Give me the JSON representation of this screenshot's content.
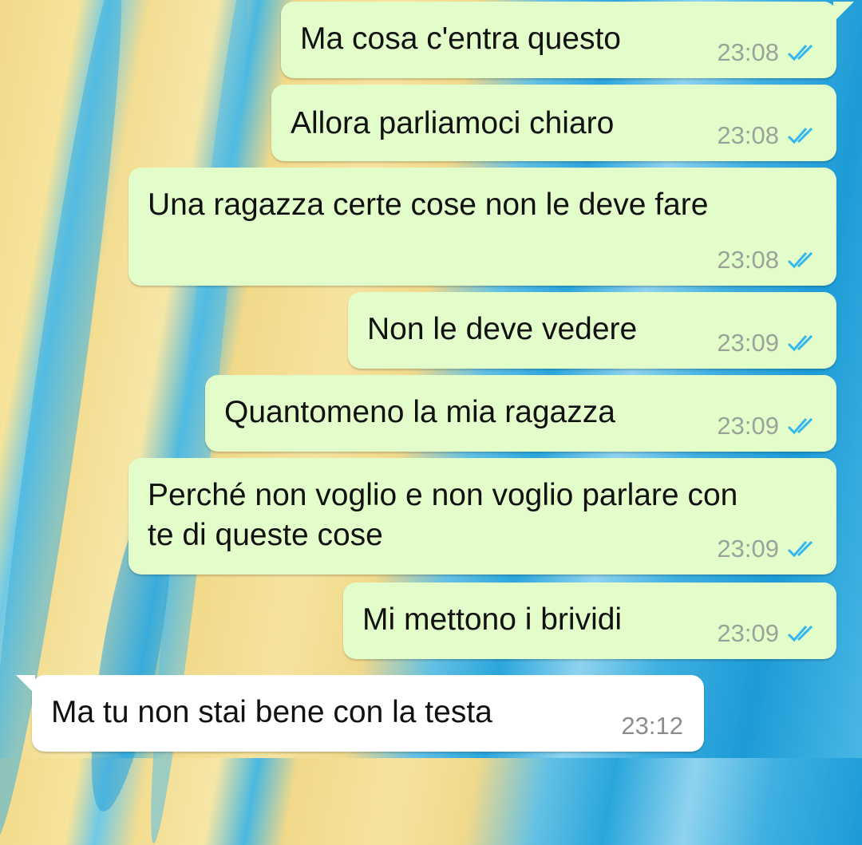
{
  "messages": [
    {
      "text": "Ma cosa c'entra questo",
      "time": "23:08",
      "direction": "outgoing",
      "status": "read"
    },
    {
      "text": "Allora parliamoci chiaro",
      "time": "23:08",
      "direction": "outgoing",
      "status": "read"
    },
    {
      "text": "Una ragazza certe cose non le deve fare",
      "time": "23:08",
      "direction": "outgoing",
      "status": "read"
    },
    {
      "text": "Non le deve vedere",
      "time": "23:09",
      "direction": "outgoing",
      "status": "read"
    },
    {
      "text": "Quantomeno la mia ragazza",
      "time": "23:09",
      "direction": "outgoing",
      "status": "read"
    },
    {
      "text": "Perché non voglio e non voglio parlare con\nte di queste cose",
      "time": "23:09",
      "direction": "outgoing",
      "status": "read"
    },
    {
      "text": "Mi mettono i brividi",
      "time": "23:09",
      "direction": "outgoing",
      "status": "read"
    },
    {
      "text": "Ma tu non stai bene con la testa",
      "time": "23:12",
      "direction": "incoming",
      "status": ""
    }
  ],
  "colors": {
    "outgoing_bubble": "#e2fdc9",
    "incoming_bubble": "#ffffff",
    "read_tick": "#34b7f1",
    "timestamp": "#9aa39a"
  },
  "icons": {
    "read_status": "double-check-icon"
  }
}
